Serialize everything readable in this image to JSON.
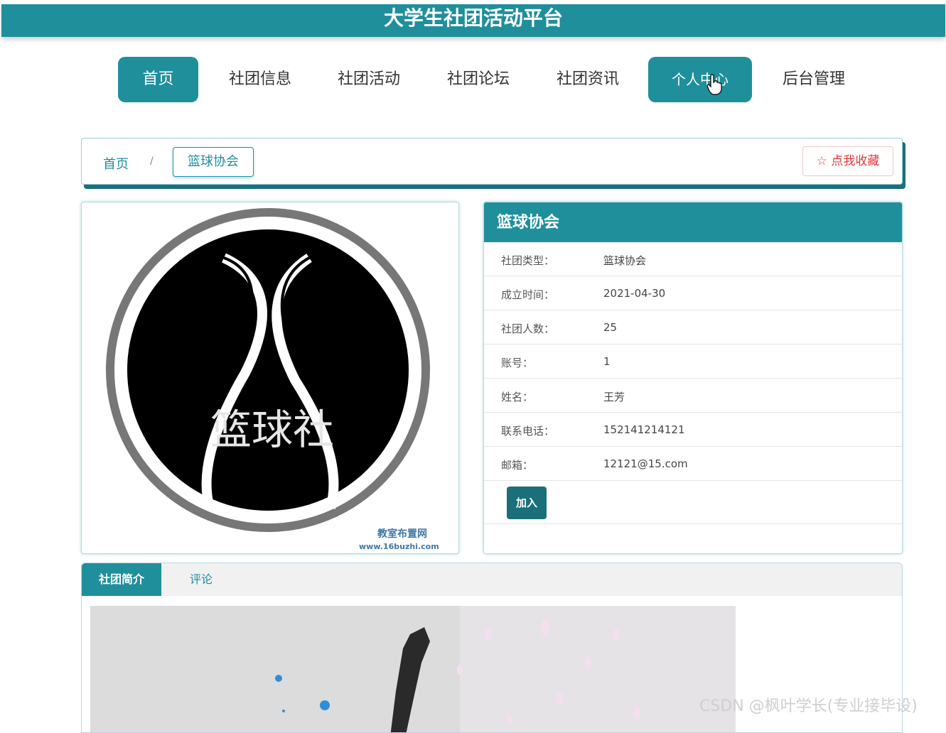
{
  "header": {
    "title": "大学生社团活动平台"
  },
  "nav": {
    "items": [
      {
        "label": "首页",
        "active": true
      },
      {
        "label": "社团信息",
        "active": false
      },
      {
        "label": "社团活动",
        "active": false
      },
      {
        "label": "社团论坛",
        "active": false
      },
      {
        "label": "社团资讯",
        "active": false
      },
      {
        "label": "个人中心",
        "active": true
      },
      {
        "label": "后台管理",
        "active": false
      }
    ]
  },
  "breadcrumb": {
    "home": "首页",
    "separator": "/",
    "current": "篮球协会"
  },
  "favorite": {
    "label": "☆ 点我收藏"
  },
  "club_image": {
    "logo_text": "篮球社",
    "watermark_line1": "教室布置网",
    "watermark_line2": "www.16buzhi.com"
  },
  "info": {
    "title": "篮球协会",
    "rows": [
      {
        "label": "社团类型：",
        "value": "篮球协会"
      },
      {
        "label": "成立时间：",
        "value": "2021-04-30"
      },
      {
        "label": "社团人数：",
        "value": "25"
      },
      {
        "label": "账号：",
        "value": "1"
      },
      {
        "label": "姓名：",
        "value": "王芳"
      },
      {
        "label": "联系电话：",
        "value": "152141214121"
      },
      {
        "label": "邮箱：",
        "value": "12121@15.com"
      }
    ],
    "join_label": "加入"
  },
  "tabs": [
    {
      "label": "社团简介",
      "active": true
    },
    {
      "label": "评论",
      "active": false
    }
  ],
  "watermark": {
    "text": "CSDN @枫叶学长(专业接毕设)"
  },
  "colors": {
    "primary": "#1f8f9c",
    "dark_teal": "#1a6f7b",
    "favorite_red": "#e4393c"
  }
}
